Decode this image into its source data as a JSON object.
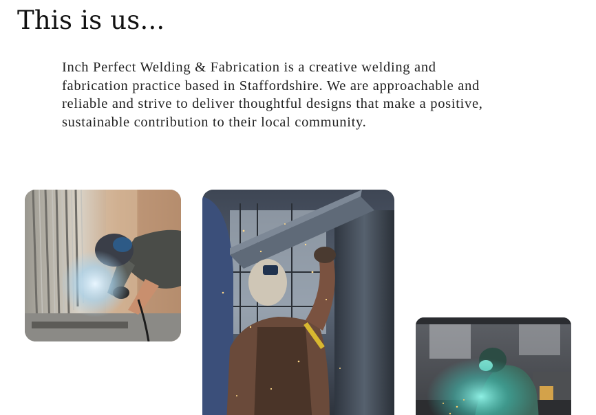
{
  "section": {
    "heading": "This is us...",
    "intro": "Inch Perfect Welding & Fabrication is a creative welding and fabrication practice based in Staffordshire. We are approachable and reliable and strive to deliver thoughtful designs that make a positive, sustainable contribution to their local community."
  },
  "gallery": {
    "photos": [
      {
        "subject": "welder leaning over long metal frame, helmet on, sparks at torch"
      },
      {
        "subject": "welder in face shield working on steel beam overhead with sparks"
      },
      {
        "subject": "welder in teal-lit workshop with green helmet and sparks"
      }
    ]
  },
  "colors": {
    "background": "#ffffff",
    "text": "#1b1b1b"
  }
}
